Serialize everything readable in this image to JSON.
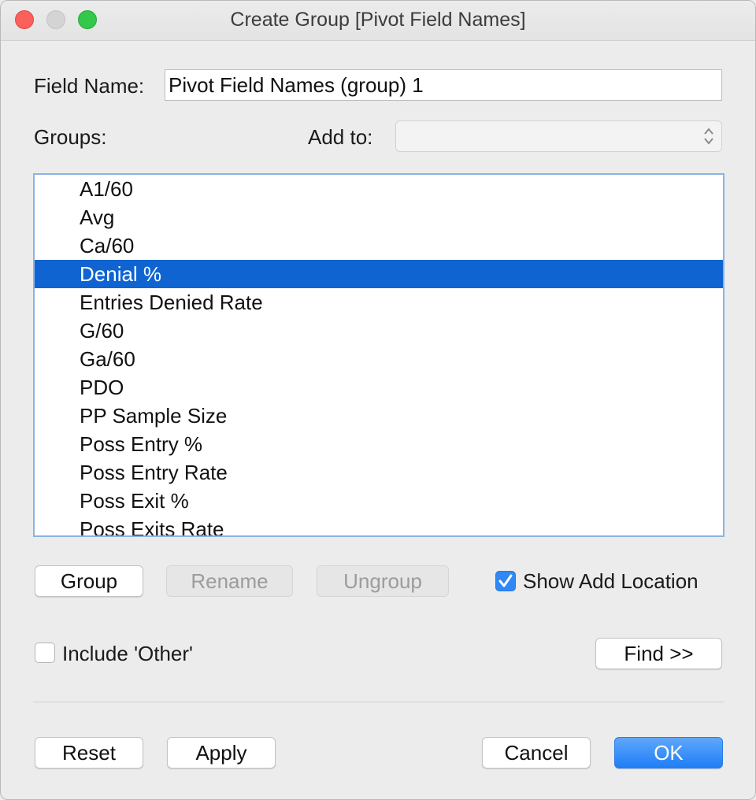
{
  "window": {
    "title": "Create Group [Pivot Field Names]"
  },
  "field_name": {
    "label": "Field Name:",
    "value": "Pivot Field Names (group) 1"
  },
  "groups": {
    "label": "Groups:"
  },
  "add_to": {
    "label": "Add to:",
    "value": ""
  },
  "list": {
    "items": [
      "A1/60",
      "Avg",
      "Ca/60",
      "Denial %",
      "Entries Denied Rate",
      "G/60",
      "Ga/60",
      "PDO",
      "PP Sample Size",
      "Poss Entry %",
      "Poss Entry Rate",
      "Poss Exit %",
      "Poss Exits Rate"
    ],
    "selected": "Denial %"
  },
  "buttons": {
    "group": "Group",
    "rename": "Rename",
    "ungroup": "Ungroup",
    "find": "Find >>",
    "reset": "Reset",
    "apply": "Apply",
    "cancel": "Cancel",
    "ok": "OK"
  },
  "show_add_location": {
    "label": "Show Add Location",
    "checked": true
  },
  "include_other": {
    "label": "Include 'Other'",
    "checked": false
  },
  "colors": {
    "selection": "#0f64d2",
    "primary_button": "#1f7ef6",
    "checkbox_checked": "#2f88f5",
    "close": "#fc605c",
    "maximize": "#34c84a"
  }
}
